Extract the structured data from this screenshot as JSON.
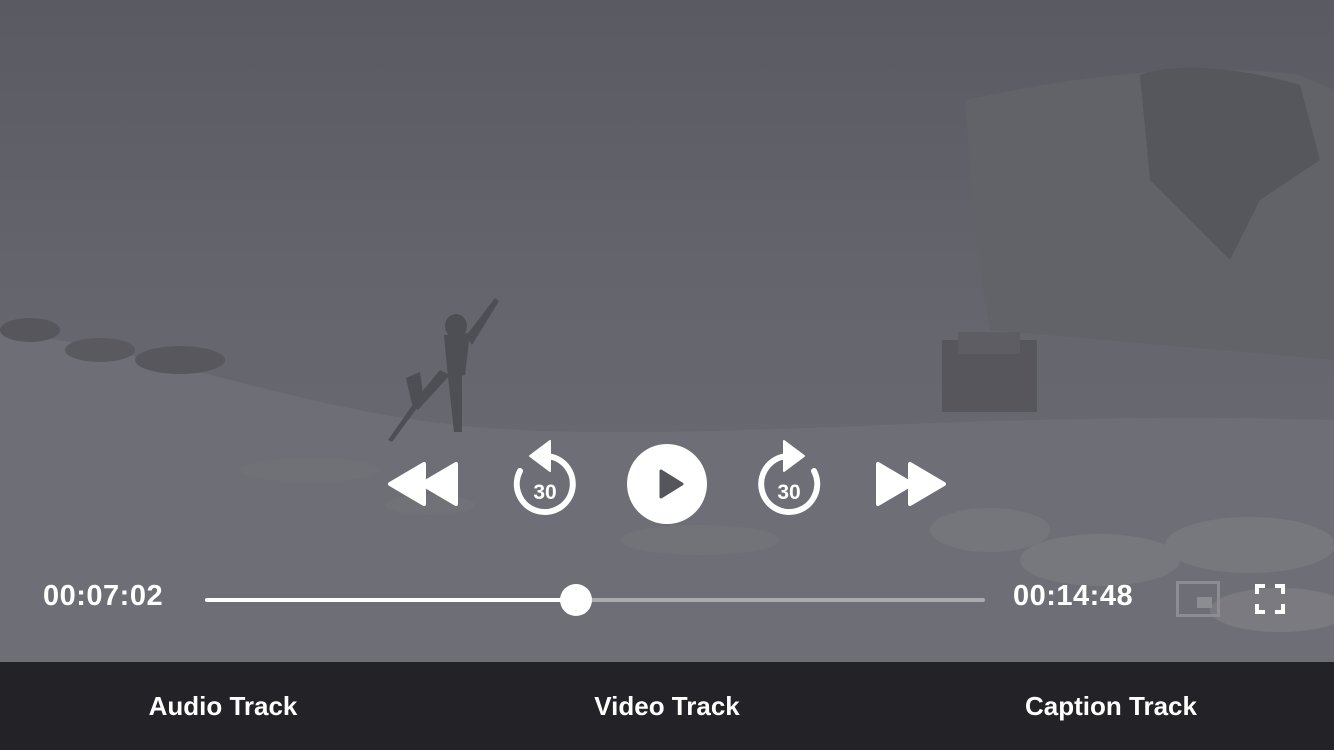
{
  "player": {
    "elapsed": "00:07:02",
    "duration": "00:14:48",
    "progress_fraction": 0.475,
    "skip_back_label": "30",
    "skip_forward_label": "30",
    "controls": {
      "rewind": "rewind-icon",
      "skip_back": "skip-back-30-icon",
      "play": "play-icon",
      "skip_forward": "skip-forward-30-icon",
      "fast_forward": "fast-forward-icon",
      "pip": "picture-in-picture-icon",
      "fullscreen": "fullscreen-icon"
    }
  },
  "tabs": [
    {
      "label": "Audio Track"
    },
    {
      "label": "Video Track"
    },
    {
      "label": "Caption Track"
    }
  ]
}
